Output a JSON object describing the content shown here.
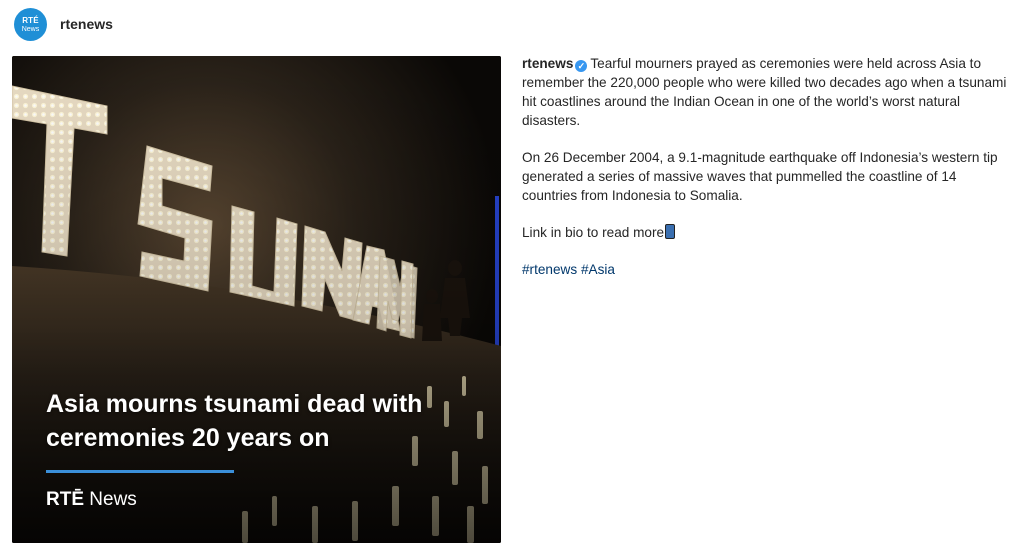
{
  "header": {
    "avatar_line1": "RTÉ",
    "avatar_line2": "News",
    "username": "rtenews"
  },
  "image": {
    "headline": "Asia mourns tsunami dead with ceremonies 20 years on",
    "sign_letters": [
      "T",
      "S",
      "U",
      "N",
      "A",
      "M",
      "I"
    ],
    "brand_rte": "RTĒ",
    "brand_news": "News",
    "accent_color": "#3b8fd9"
  },
  "caption": {
    "username": "rtenews",
    "paragraph1": "Tearful mourners prayed as ceremonies were held across Asia to remember the 220,000 people who were killed two decades ago when a tsunami hit coastlines around the Indian Ocean in one of the world’s worst natural disasters.",
    "paragraph2": "On 26 December 2004, a 9.1-magnitude earthquake off Indonesia’s western tip generated a series of massive waves that pummelled the coastline of 14 countries from Indonesia to Somalia.",
    "link_text": "Link in bio to read more",
    "link_icon": "mobile-phone-icon",
    "hashtags": [
      "#rtenews",
      "#Asia"
    ]
  },
  "colors": {
    "verified": "#3797f0",
    "hashtag": "#00376b",
    "avatar": "#1f8fd6"
  }
}
